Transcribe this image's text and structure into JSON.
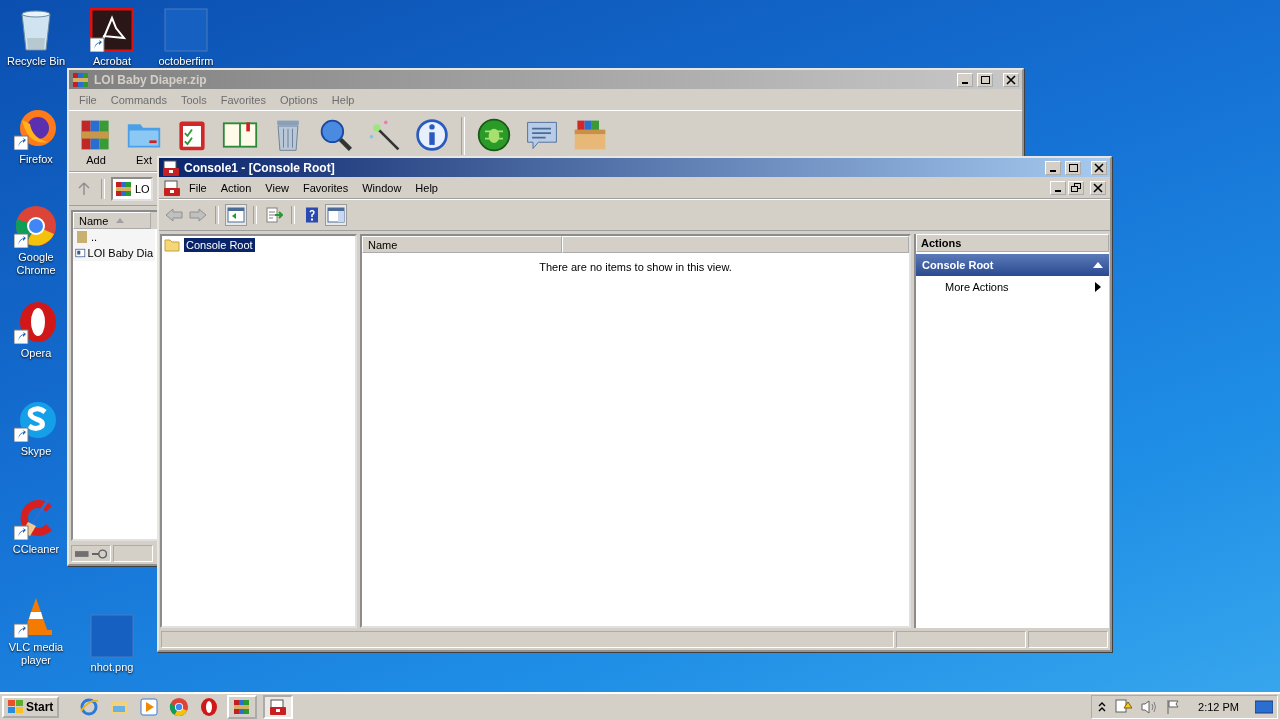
{
  "desktop_icons": [
    {
      "kind": "recycle",
      "label": "Recycle Bin"
    },
    {
      "kind": "acrobat",
      "label": "Acrobat"
    },
    {
      "kind": "blank",
      "label": "octoberfirm"
    },
    {
      "kind": "firefox",
      "label": "Firefox"
    },
    {
      "kind": "chrome",
      "label": "Google Chrome"
    },
    {
      "kind": "opera",
      "label": "Opera"
    },
    {
      "kind": "skype",
      "label": "Skype"
    },
    {
      "kind": "ccleaner",
      "label": "CCleaner"
    },
    {
      "kind": "vlc",
      "label": "VLC media player"
    },
    {
      "kind": "blank",
      "label": "nhot.png"
    }
  ],
  "archive_window": {
    "title": "LOI Baby Diaper.zip",
    "menu": [
      "File",
      "Commands",
      "Tools",
      "Favorites",
      "Options",
      "Help"
    ],
    "toolbar_labels": [
      "Add",
      "Ext"
    ],
    "address": "LO",
    "columns": [
      "Name"
    ],
    "rows": [
      {
        "kind": "up",
        "name": ".."
      },
      {
        "kind": "file",
        "name": "LOI Baby Dia"
      }
    ]
  },
  "console_window": {
    "title": "Console1 - [Console Root]",
    "menu": [
      "File",
      "Action",
      "View",
      "Favorites",
      "Window",
      "Help"
    ],
    "tree": [
      {
        "label": "Console Root",
        "selected": true
      }
    ],
    "columns": [
      "Name"
    ],
    "empty_message": "There are no items to show in this view.",
    "actions": {
      "title": "Actions",
      "section": "Console Root",
      "items": [
        {
          "label": "More Actions",
          "submenu": true
        }
      ]
    }
  },
  "taskbar": {
    "start": "Start",
    "quick_launch": [
      {
        "kind": "ie"
      },
      {
        "kind": "explorer"
      },
      {
        "kind": "media"
      },
      {
        "kind": "chrome"
      },
      {
        "kind": "opera"
      }
    ],
    "tasks": [
      {
        "kind": "archive",
        "selected": false
      },
      {
        "kind": "console",
        "selected": true
      }
    ],
    "clock": "2:12 PM"
  }
}
